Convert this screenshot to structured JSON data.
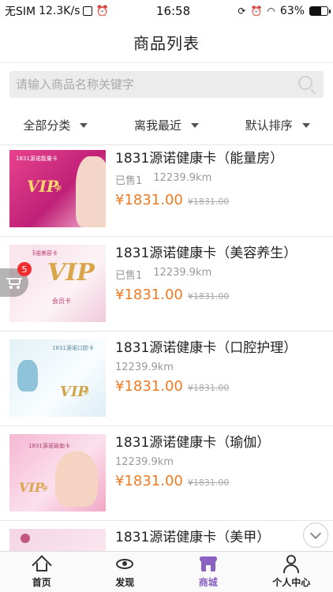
{
  "status_bar": {
    "carrier": "无SIM",
    "speed": "12.3K/s",
    "time": "16:58",
    "battery": "63%",
    "battery_level": 0.63
  },
  "header": {
    "title": "商品列表"
  },
  "search": {
    "placeholder": "请输入商品名称关键字",
    "value": ""
  },
  "filters": [
    {
      "label": "全部分类"
    },
    {
      "label": "离我最近"
    },
    {
      "label": "默认排序"
    }
  ],
  "products": [
    {
      "name": "1831源诺健康卡（能量房）",
      "sold": "已售1",
      "distance": "12239.9km",
      "price": "¥1831.00",
      "original_price": "¥1831.00",
      "card_label": "1831源诺能量卡"
    },
    {
      "name": "1831源诺健康卡（美容养生）",
      "sold": "已售1",
      "distance": "12239.9km",
      "price": "¥1831.00",
      "original_price": "¥1831.00",
      "card_label": "1831源诺美容卡"
    },
    {
      "name": "1831源诺健康卡（口腔护理）",
      "sold": "",
      "distance": "12239.9km",
      "price": "¥1831.00",
      "original_price": "¥1831.00",
      "card_label": "1831源诺口腔卡"
    },
    {
      "name": "1831源诺健康卡（瑜伽）",
      "sold": "",
      "distance": "12239.9km",
      "price": "¥1831.00",
      "original_price": "¥1831.00",
      "card_label": "1831源诺瑜伽卡"
    },
    {
      "name": "1831源诺健康卡（美甲）",
      "sold": "",
      "distance": "",
      "price": "",
      "original_price": "",
      "card_label": ""
    }
  ],
  "thumb_text": {
    "vip": "VIP",
    "ka": "卡",
    "member_card": "会员卡"
  },
  "cart": {
    "badge_count": "5"
  },
  "tabs": [
    {
      "label": "首页",
      "icon": "home-icon"
    },
    {
      "label": "发现",
      "icon": "eye-icon"
    },
    {
      "label": "商城",
      "icon": "store-icon",
      "active": true
    },
    {
      "label": "个人中心",
      "icon": "person-icon"
    }
  ],
  "colors": {
    "accent": "#8a62c4",
    "price": "#f07a22",
    "badge": "#f02d2d"
  }
}
